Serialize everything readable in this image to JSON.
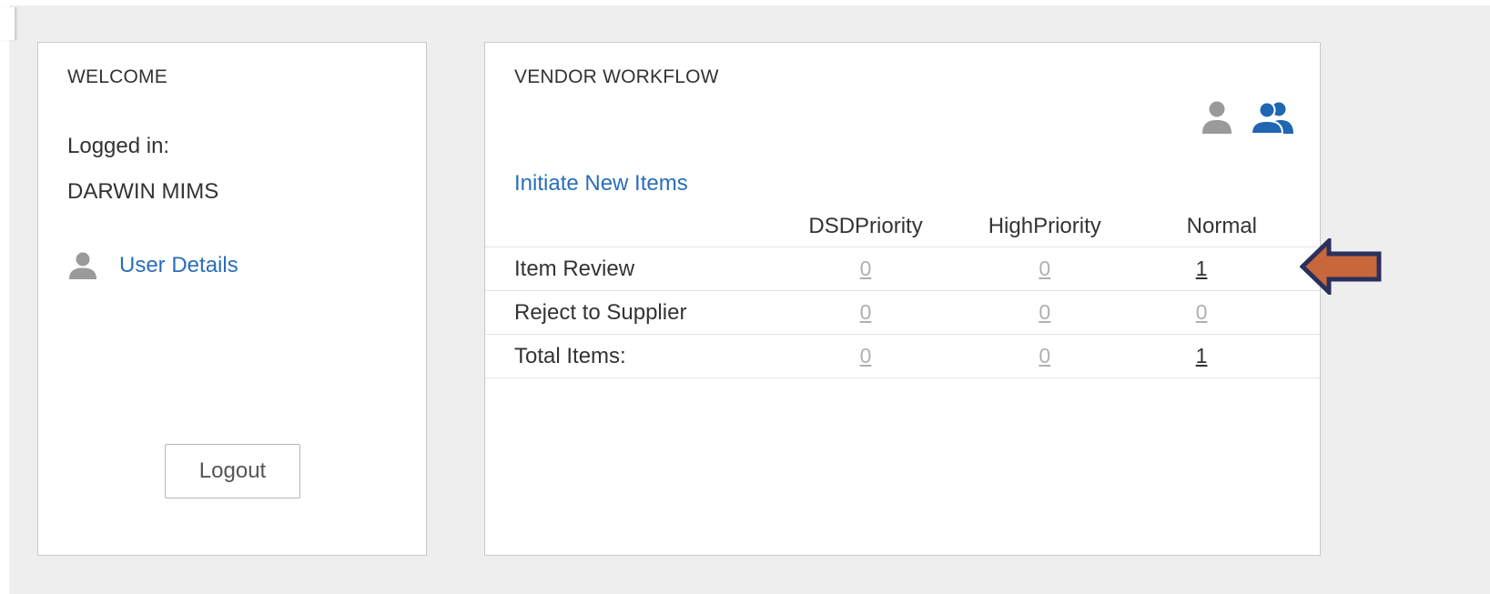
{
  "welcome": {
    "title": "WELCOME",
    "logged_label": "Logged in:",
    "user_name": "DARWIN MIMS",
    "user_details_link": "User Details",
    "logout_label": "Logout"
  },
  "workflow": {
    "title": "VENDOR WORKFLOW",
    "initiate_link": "Initiate New Items",
    "columns": [
      "DSDPriority",
      "HighPriority",
      "Normal"
    ],
    "rows": [
      {
        "label": "Item Review",
        "dsd": "0",
        "high": "0",
        "normal": "1"
      },
      {
        "label": "Reject to Supplier",
        "dsd": "0",
        "high": "0",
        "normal": "0"
      },
      {
        "label": "Total Items:",
        "dsd": "0",
        "high": "0",
        "normal": "1"
      }
    ]
  },
  "icons": {
    "user_icon": "person-icon",
    "single_user_view": "single-user-icon",
    "group_view": "group-users-icon",
    "annotation": "arrow-left-icon"
  },
  "colors": {
    "link": "#2a6ebb",
    "group_icon_active": "#1f66b3",
    "single_icon_inactive": "#9a9a9a",
    "arrow_fill": "#c8673a",
    "arrow_stroke": "#2b2f5c"
  }
}
